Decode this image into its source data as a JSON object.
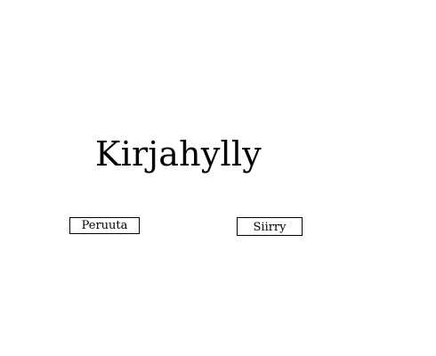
{
  "title": "Kirjahylly",
  "buttons": {
    "cancel_label": "Peruuta",
    "go_label": "Siirry"
  },
  "colors": {
    "background": "#ffffff",
    "text": "#000000",
    "button_border": "#000000"
  }
}
